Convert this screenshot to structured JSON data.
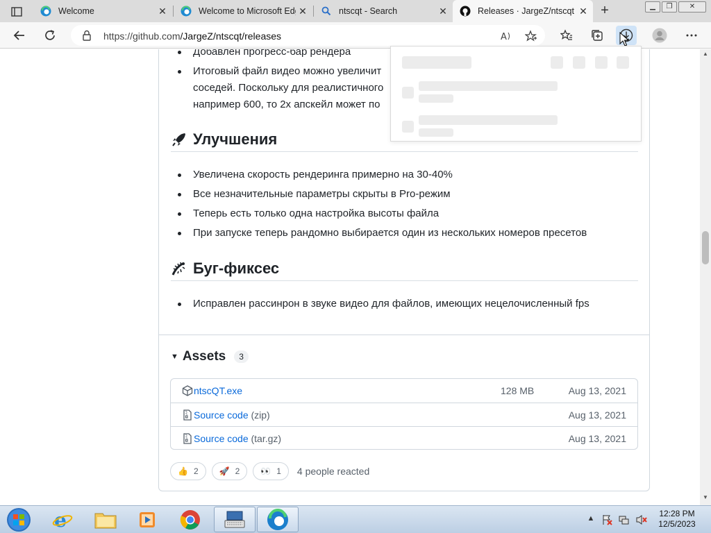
{
  "browser": {
    "tabs": [
      {
        "title": "Welcome",
        "icon": "edge-icon",
        "active": false
      },
      {
        "title": "Welcome to Microsoft Edge",
        "icon": "edge-icon",
        "active": false
      },
      {
        "title": "ntscqt - Search",
        "icon": "search-icon",
        "active": false
      },
      {
        "title": "Releases · JargeZ/ntscqt",
        "icon": "github-icon",
        "active": true
      }
    ],
    "url_host": "https://github.com",
    "url_path": "/JargeZ/ntscqt/releases"
  },
  "content": {
    "top_bullets": [
      "Добавлен прогресс-бар рендера",
      "Итоговый файл видео можно увеличит",
      "соседей. Поскольку для реалистичного",
      "например 600, то 2x апскейл может по"
    ],
    "improvements_heading": "Улучшения",
    "improvements": [
      "Увеличена скорость рендеринга примерно на 30-40%",
      "Все незначительные параметры скрыты в Pro-режим",
      "Теперь есть только одна настройка высоты файла",
      "При запуске теперь рандомно выбирается один из нескольких номеров пресетов"
    ],
    "bugfixes_heading": "Буг-фиксес",
    "bugfixes": [
      "Исправлен рассинрон в звуке видео для файлов, имеющих нецелочисленный fps"
    ]
  },
  "assets": {
    "label": "Assets",
    "count": "3",
    "items": [
      {
        "name": "ntscQT.exe",
        "suffix": "",
        "size": "128 MB",
        "date": "Aug 13, 2021",
        "icon": "package-icon"
      },
      {
        "name": "Source code",
        "suffix": "(zip)",
        "size": "",
        "date": "Aug 13, 2021",
        "icon": "file-zip-icon"
      },
      {
        "name": "Source code",
        "suffix": "(tar.gz)",
        "size": "",
        "date": "Aug 13, 2021",
        "icon": "file-zip-icon"
      }
    ]
  },
  "reactions": {
    "items": [
      {
        "emoji": "👍",
        "count": "2"
      },
      {
        "emoji": "🚀",
        "count": "2"
      },
      {
        "emoji": "👀",
        "count": "1"
      }
    ],
    "summary": "4 people reacted"
  },
  "taskbar": {
    "time": "12:28 PM",
    "date": "12/5/2023"
  },
  "colors": {
    "link": "#0969da",
    "tab_strip": "#dcdcdc",
    "download_active": "#cfe3f7"
  }
}
